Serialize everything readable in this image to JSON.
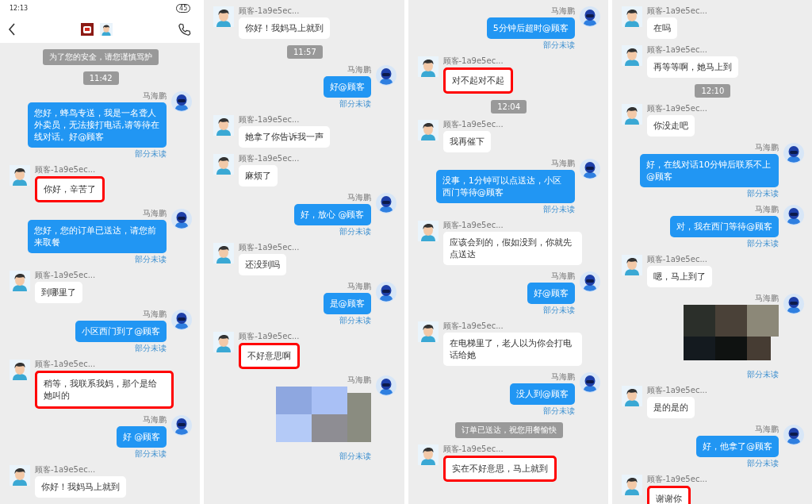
{
  "panels": [
    {
      "status_bar": {
        "time": "12:13",
        "battery": "45"
      },
      "header": {
        "kind": "chat"
      },
      "messages": [
        {
          "kind": "notice",
          "text": "为了您的安全，请您谨慎骂护"
        },
        {
          "kind": "time",
          "text": "11:42"
        },
        {
          "kind": "outgoing",
          "sender": "马海鹏",
          "text": "您好，蜂鸟专送，我是一名聋人外卖员，无法接打电话,请等待在线对话。好@顾客",
          "status": "部分未读"
        },
        {
          "kind": "incoming",
          "sender": "顾客-1a9e5ec...",
          "text": "你好，辛苦了",
          "highlighted": true
        },
        {
          "kind": "outgoing",
          "sender": "马海鹏",
          "text": "您好，您的订单已送达，请您前来取餐",
          "status": "部分未读"
        },
        {
          "kind": "incoming",
          "sender": "顾客-1a9e5ec...",
          "text": "到哪里了",
          "highlighted": false
        },
        {
          "kind": "outgoing",
          "sender": "马海鹏",
          "text": "小区西门到了@顾客",
          "status": "部分未读"
        },
        {
          "kind": "incoming",
          "sender": "顾客-1a9e5ec...",
          "text": "稍等，我联系我妈，那个是给她叫的",
          "highlighted": true
        },
        {
          "kind": "outgoing",
          "sender": "马海鹏",
          "text": "好 @顾客",
          "status": "部分未读"
        },
        {
          "kind": "incoming",
          "sender": "顾客-1a9e5ec...",
          "text": "你好！我妈马上就到",
          "highlighted": false
        }
      ]
    },
    {
      "messages": [
        {
          "kind": "incoming",
          "sender": "顾客-1a9e5ec...",
          "text": "你好！我妈马上就到",
          "highlighted": false
        },
        {
          "kind": "time",
          "text": "11:57"
        },
        {
          "kind": "outgoing",
          "sender": "马海鹏",
          "text": "好@顾客",
          "status": "部分未读"
        },
        {
          "kind": "incoming",
          "sender": "顾客-1a9e5ec...",
          "text": "她拿了你告诉我一声",
          "highlighted": false
        },
        {
          "kind": "incoming",
          "sender": "顾客-1a9e5ec...",
          "text": "麻烦了",
          "highlighted": false
        },
        {
          "kind": "outgoing",
          "sender": "马海鹏",
          "text": "好，放心 @顾客",
          "status": "部分未读"
        },
        {
          "kind": "incoming",
          "sender": "顾客-1a9e5ec...",
          "text": "还没到吗",
          "highlighted": false
        },
        {
          "kind": "outgoing",
          "sender": "马海鹏",
          "text": "是@顾客",
          "status": "部分未读"
        },
        {
          "kind": "incoming",
          "sender": "顾客-1a9e5ec...",
          "text": "不好意思啊",
          "highlighted": true
        },
        {
          "sender": "马海鹏",
          "status": "部分未读"
        }
      ]
    },
    {
      "messages": [
        {
          "kind": "outgoing",
          "sender": "马海鹏",
          "text": "5分钟后超时@顾客",
          "status": "部分未读"
        },
        {
          "kind": "incoming",
          "sender": "顾客-1a9e5ec...",
          "text": "对不起对不起",
          "highlighted": true
        },
        {
          "kind": "time",
          "text": "12:04"
        },
        {
          "kind": "incoming",
          "sender": "顾客-1a9e5ec...",
          "text": "我再催下",
          "highlighted": false
        },
        {
          "kind": "outgoing",
          "sender": "马海鹏",
          "text": "没事，1分钟可以点送达，小区西门等待@顾客",
          "status": "部分未读"
        },
        {
          "kind": "incoming",
          "sender": "顾客-1a9e5ec...",
          "text": "应该会到的，假如没到，你就先点送达",
          "highlighted": false
        },
        {
          "kind": "outgoing",
          "sender": "马海鹏",
          "text": "好@顾客",
          "status": "部分未读"
        },
        {
          "kind": "incoming",
          "sender": "顾客-1a9e5ec...",
          "text": "在电梯里了，老人以为你会打电话给她",
          "highlighted": false
        },
        {
          "kind": "outgoing",
          "sender": "马海鹏",
          "text": "没人到@顾客",
          "status": "部分未读"
        },
        {
          "kind": "notice",
          "text": "订单已送达，祝您用餐愉快"
        },
        {
          "kind": "incoming",
          "sender": "顾客-1a9e5ec...",
          "text": "实在不好意思，马上就到",
          "highlighted": true
        }
      ]
    },
    {
      "messages": [
        {
          "kind": "incoming",
          "sender": "顾客-1a9e5ec...",
          "text": "在吗",
          "highlighted": false
        },
        {
          "kind": "incoming",
          "sender": "顾客-1a9e5ec...",
          "text": "再等等啊，她马上到",
          "highlighted": false
        },
        {
          "kind": "time",
          "text": "12:10"
        },
        {
          "kind": "incoming",
          "sender": "顾客-1a9e5ec...",
          "text": "你没走吧",
          "highlighted": false
        },
        {
          "kind": "outgoing",
          "sender": "马海鹏",
          "text": "好，在线对话10分钟后联系不上@顾客",
          "status": "部分未读"
        },
        {
          "kind": "outgoing",
          "sender": "马海鹏",
          "text": "对，我在西门等待@顾客",
          "status": "部分未读"
        },
        {
          "kind": "incoming",
          "sender": "顾客-1a9e5ec...",
          "text": "嗯，马上到了",
          "highlighted": false
        },
        {
          "sender": "马海鹏",
          "status": "部分未读"
        },
        {
          "kind": "incoming",
          "sender": "顾客-1a9e5ec...",
          "text": "是的是的",
          "highlighted": false
        },
        {
          "kind": "outgoing",
          "sender": "马海鹏",
          "text": "好，他拿了@顾客",
          "status": "部分未读"
        },
        {
          "kind": "incoming",
          "sender": "顾客-1a9e5ec...",
          "text": "谢谢你",
          "highlighted": true
        }
      ]
    }
  ]
}
